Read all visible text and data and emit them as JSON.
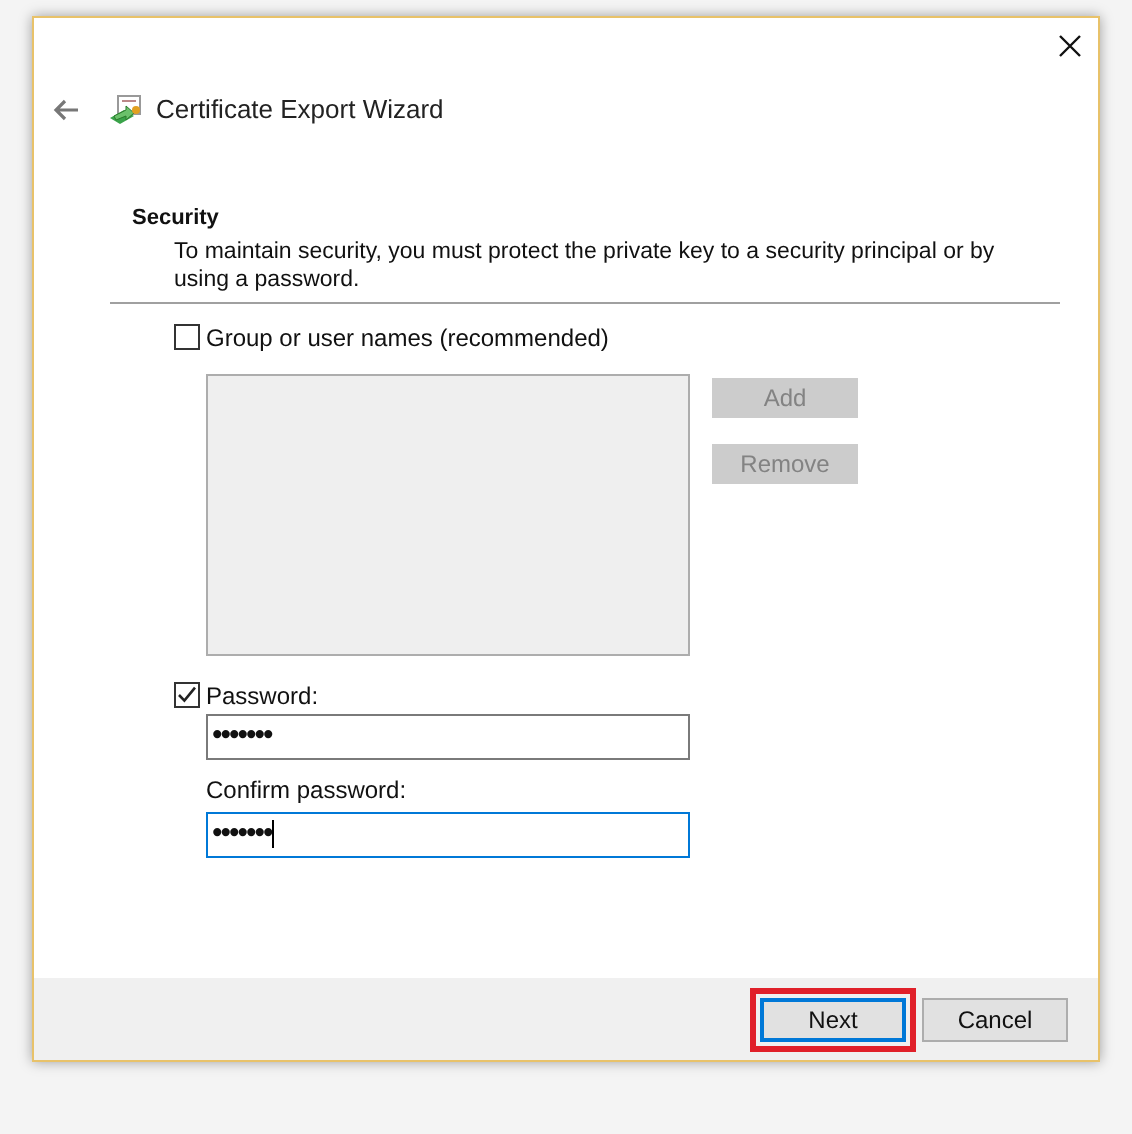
{
  "window": {
    "title": "Certificate Export Wizard"
  },
  "section": {
    "heading": "Security",
    "description": "To maintain security, you must protect the private key to a security principal or by using a password."
  },
  "group_option": {
    "label": "Group or user names (recommended)",
    "checked": false
  },
  "side_buttons": [
    {
      "label": "Add",
      "disabled": true
    },
    {
      "label": "Remove",
      "disabled": true
    }
  ],
  "password_option": {
    "label": "Password:",
    "checked": true
  },
  "fields": [
    {
      "value": "•••••••",
      "focused": false
    },
    {
      "label": "Confirm password:",
      "value": "•••••••",
      "focused": true
    }
  ],
  "footer_buttons": [
    {
      "label": "Next",
      "default": true,
      "highlighted": true
    },
    {
      "label": "Cancel",
      "default": false,
      "highlighted": false
    }
  ]
}
